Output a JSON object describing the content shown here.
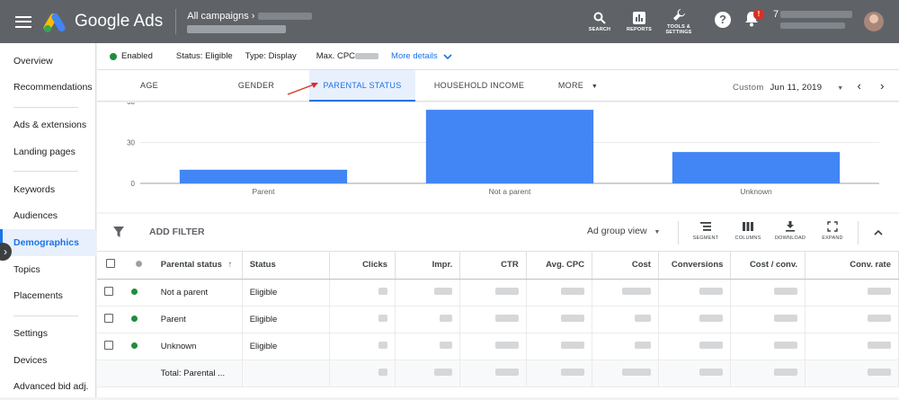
{
  "topbar": {
    "brand": "Google Ads",
    "breadcrumb": "All campaigns",
    "icons": [
      {
        "name": "search-icon",
        "label": "SEARCH"
      },
      {
        "name": "reports-icon",
        "label": "REPORTS"
      },
      {
        "name": "wrench-icon",
        "label": "TOOLS & SETTINGS"
      }
    ],
    "notification_badge": "!",
    "account_prefix": "7"
  },
  "sidebar": {
    "items": [
      {
        "label": "Overview"
      },
      {
        "label": "Recommendations"
      },
      {
        "label": "Ads & extensions"
      },
      {
        "label": "Landing pages"
      },
      {
        "label": "Keywords"
      },
      {
        "label": "Audiences"
      },
      {
        "label": "Demographics",
        "active": true
      },
      {
        "label": "Topics"
      },
      {
        "label": "Placements"
      },
      {
        "label": "Settings"
      },
      {
        "label": "Devices"
      },
      {
        "label": "Advanced bid adj."
      }
    ]
  },
  "status": {
    "enabled": "Enabled",
    "status": "Status: Eligible",
    "type": "Type: Display",
    "max_cpc": "Max. CPC",
    "more_details": "More details"
  },
  "tabs": [
    {
      "label": "AGE"
    },
    {
      "label": "GENDER"
    },
    {
      "label": "PARENTAL STATUS",
      "active": true
    },
    {
      "label": "HOUSEHOLD INCOME"
    },
    {
      "label": "MORE"
    }
  ],
  "daterange": {
    "label": "Custom",
    "value": "Jun 11, 2019"
  },
  "chart_data": {
    "type": "bar",
    "categories": [
      "Parent",
      "Not a parent",
      "Unknown"
    ],
    "values": [
      10,
      54,
      23
    ],
    "yticks": [
      0,
      30,
      60
    ],
    "ylim": [
      0,
      62
    ],
    "color": "#4285f4"
  },
  "toolbar": {
    "add_filter": "ADD FILTER",
    "view": "Ad group view",
    "buttons": [
      "SEGMENT",
      "COLUMNS",
      "DOWNLOAD",
      "EXPAND"
    ]
  },
  "table": {
    "headers": [
      "Parental status",
      "Status",
      "Clicks",
      "Impr.",
      "CTR",
      "Avg. CPC",
      "Cost",
      "Conversions",
      "Cost / conv.",
      "Conv. rate"
    ],
    "rows": [
      {
        "name": "Not a parent",
        "status": "Eligible"
      },
      {
        "name": "Parent",
        "status": "Eligible"
      },
      {
        "name": "Unknown",
        "status": "Eligible"
      }
    ],
    "total_label": "Total: Parental ..."
  }
}
